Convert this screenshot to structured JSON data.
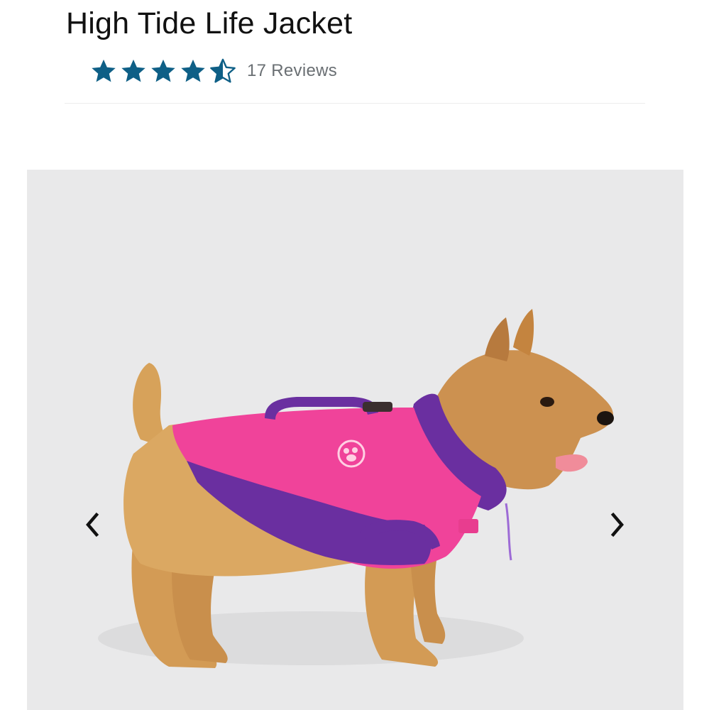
{
  "product": {
    "title": "High Tide Life Jacket",
    "rating": 4.5,
    "rating_max": 5,
    "reviews_label": "17 Reviews"
  },
  "colors": {
    "star": "#0e5f86",
    "gallery_bg": "#e9e9ea",
    "jacket_pink": "#f0439a",
    "jacket_purple": "#6a2fa0"
  },
  "gallery": {
    "image_subject": "terrier dog wearing pink and purple life jacket",
    "prev_icon": "chevron-left-icon",
    "next_icon": "chevron-right-icon"
  }
}
